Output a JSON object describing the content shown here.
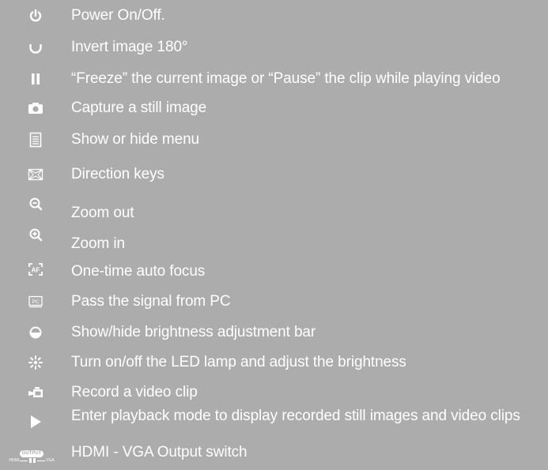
{
  "items": [
    {
      "icon": "power-icon",
      "label": "Power On/Off."
    },
    {
      "icon": "rotate-icon",
      "label": "Invert image 180°"
    },
    {
      "icon": "pause-icon",
      "label": "“Freeze” the current image or “Pause” the clip while playing video"
    },
    {
      "icon": "camera-icon",
      "label": "Capture a still image"
    },
    {
      "icon": "menu-icon",
      "label": "Show or hide menu"
    },
    {
      "icon": "direction-keys-icon",
      "label": "Direction keys"
    },
    {
      "icon": "zoom-out-icon",
      "label": "Zoom out"
    },
    {
      "icon": "zoom-in-icon",
      "label": "Zoom in"
    },
    {
      "icon": "autofocus-icon",
      "label": "One-time auto focus",
      "icon_text": "AF"
    },
    {
      "icon": "pc-icon",
      "label": "Pass the signal from PC",
      "icon_text": "PC"
    },
    {
      "icon": "brightness-icon",
      "label": "Show/hide brightness adjustment bar"
    },
    {
      "icon": "led-lamp-icon",
      "label": "Turn on/off the LED lamp and adjust the brightness"
    },
    {
      "icon": "record-video-icon",
      "label": "Record a video clip"
    },
    {
      "icon": "playback-icon",
      "label": "Enter playback mode to display recorded still images and video clips"
    },
    {
      "icon": "output-switch-icon",
      "label": "HDMI - VGA Output switch",
      "icon_text": "OUTPUT",
      "icon_left": "HDMI",
      "icon_right": "VGA"
    }
  ]
}
